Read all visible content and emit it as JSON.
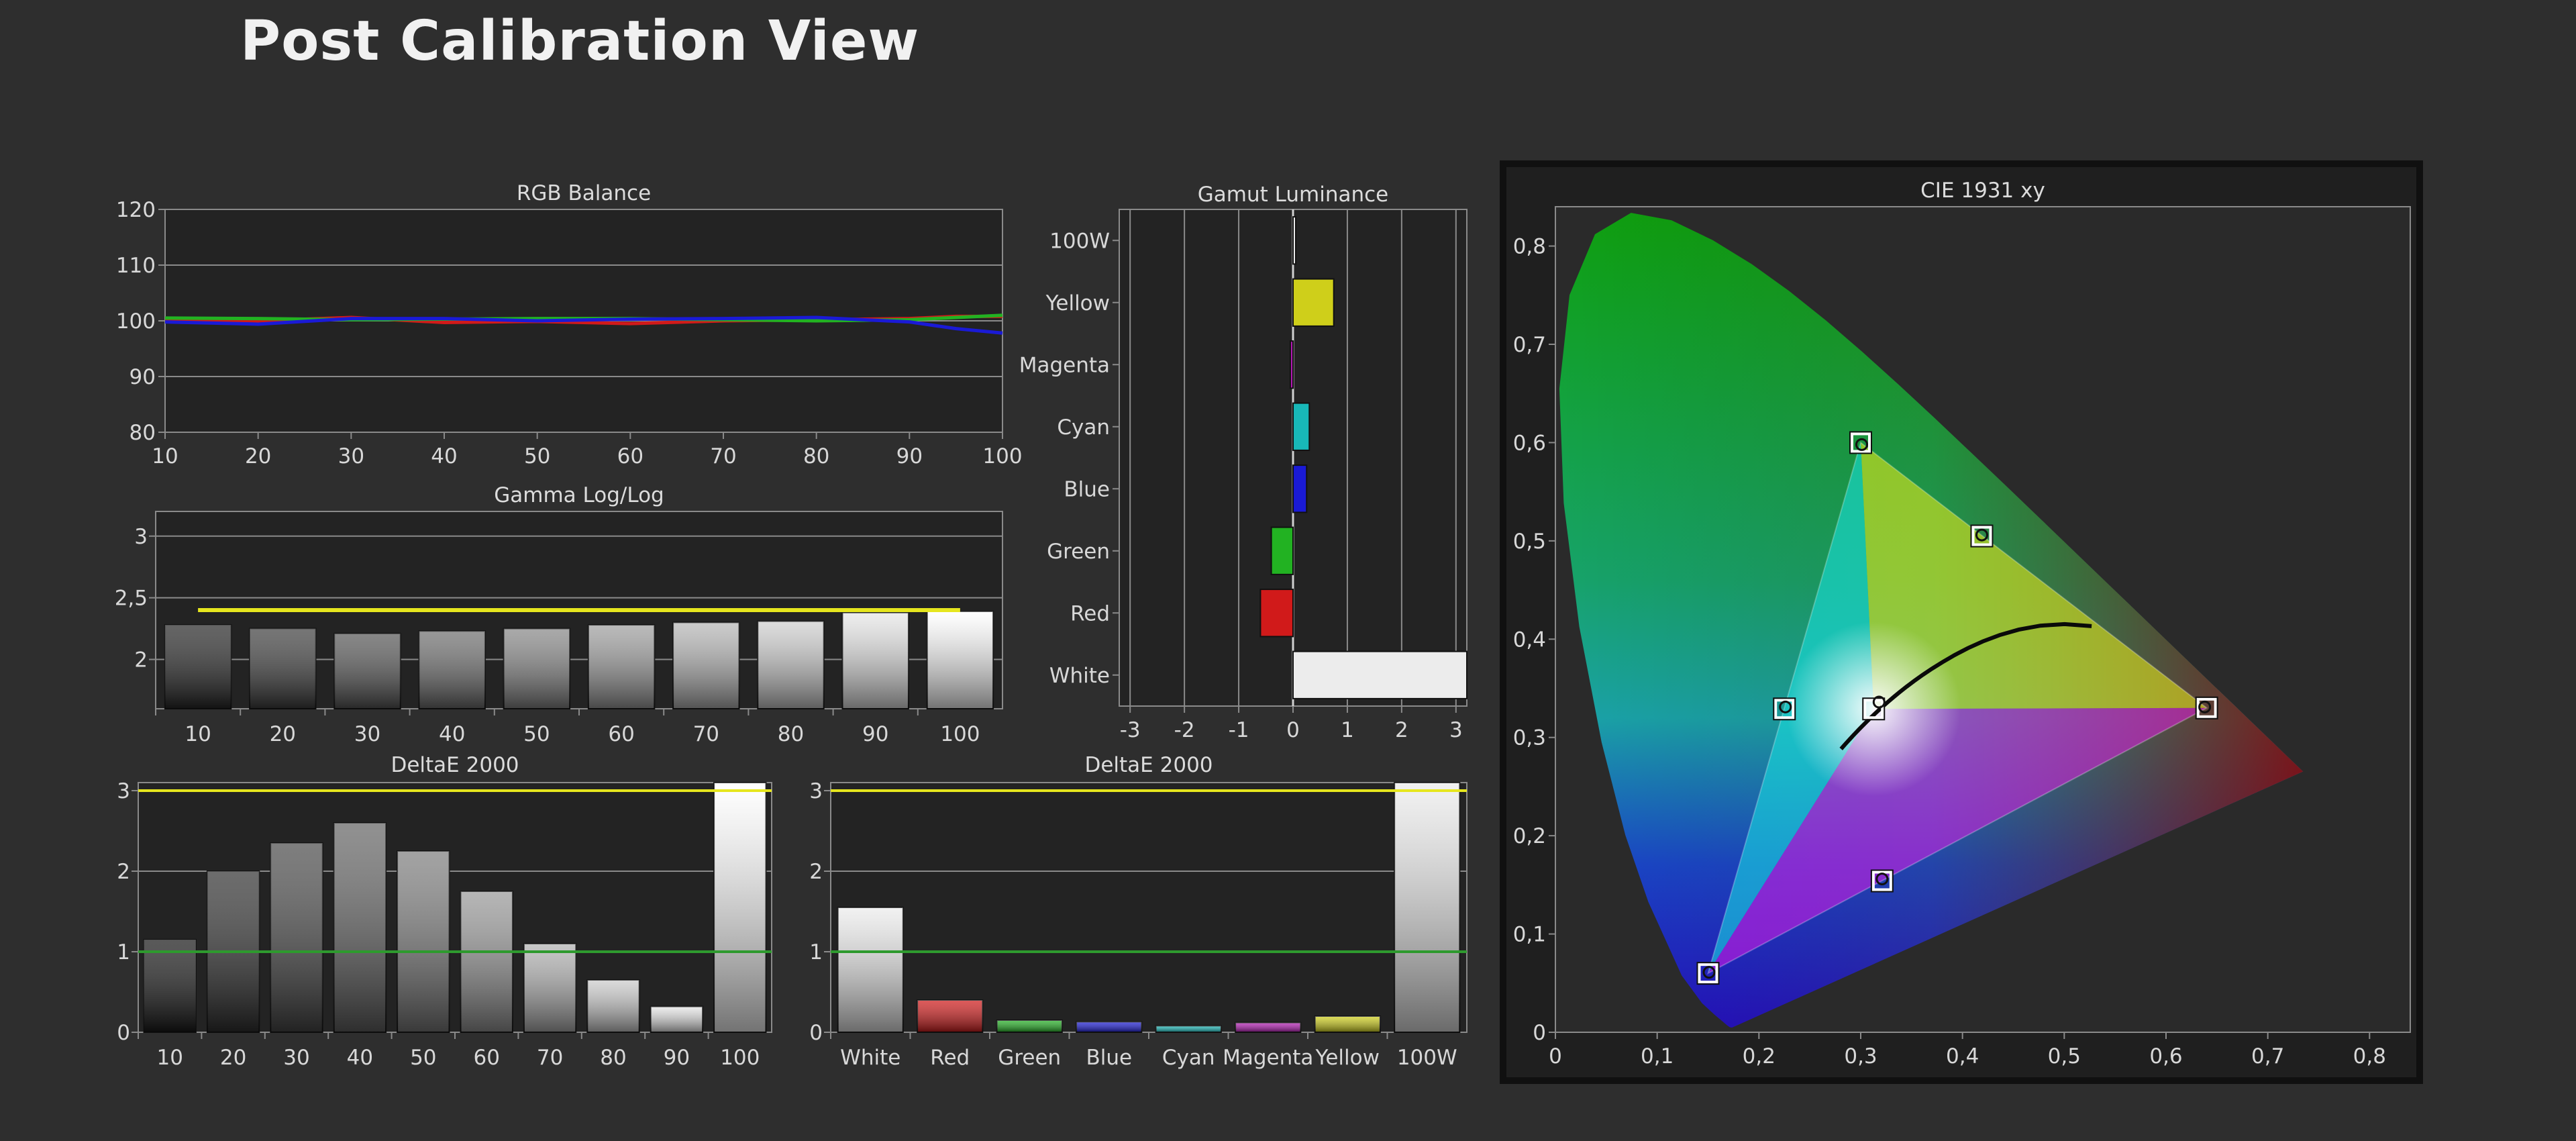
{
  "page": {
    "title": "Post Calibration View"
  },
  "colors": {
    "background": "#2e2e2e",
    "panel": "#232323",
    "grid": "#8a8a8a",
    "threshold_yellow": "#e6e61e",
    "threshold_green": "#2e9a2e",
    "red": "#d11a1a",
    "green": "#22b222",
    "blue": "#1a1ad6",
    "cyan": "#18b8b8",
    "magenta": "#b41ab4",
    "yellow": "#cfcf1a",
    "white": "#ececec"
  },
  "chart_data": [
    {
      "id": "rgb-balance",
      "type": "line",
      "title": "RGB Balance",
      "x_ticks": [
        "10",
        "20",
        "30",
        "40",
        "50",
        "60",
        "70",
        "80",
        "90",
        "100"
      ],
      "y_ticks": [
        "80",
        "90",
        "100",
        "110",
        "120"
      ],
      "xlim": [
        10,
        100
      ],
      "ylim": [
        80,
        120
      ],
      "grid": true,
      "series": [
        {
          "color": "red",
          "x": [
            10,
            20,
            30,
            40,
            50,
            60,
            70,
            80,
            90,
            95,
            100
          ],
          "y": [
            100.2,
            100.0,
            100.6,
            99.7,
            99.9,
            99.5,
            100.0,
            100.2,
            100.4,
            100.8,
            100.8
          ]
        },
        {
          "color": "green",
          "x": [
            10,
            20,
            30,
            40,
            50,
            60,
            70,
            80,
            90,
            95,
            100
          ],
          "y": [
            100.5,
            100.4,
            100.2,
            100.3,
            100.4,
            100.4,
            100.2,
            100.0,
            100.2,
            100.6,
            101.0
          ]
        },
        {
          "color": "blue",
          "x": [
            10,
            20,
            30,
            40,
            50,
            60,
            70,
            80,
            90,
            95,
            100
          ],
          "y": [
            99.8,
            99.4,
            100.4,
            100.4,
            100.0,
            100.3,
            100.4,
            100.6,
            99.8,
            98.6,
            97.8
          ]
        }
      ]
    },
    {
      "id": "gamma",
      "type": "bar",
      "title": "Gamma Log/Log",
      "categories": [
        "10",
        "20",
        "30",
        "40",
        "50",
        "60",
        "70",
        "80",
        "90",
        "100"
      ],
      "values": [
        2.28,
        2.25,
        2.21,
        2.23,
        2.25,
        2.28,
        2.3,
        2.31,
        2.38,
        2.39
      ],
      "target": 2.4,
      "y_ticks": [
        "2",
        "2,5",
        "3"
      ],
      "ylim": [
        1.6,
        3.2
      ],
      "grid": true
    },
    {
      "id": "gamut-luminance",
      "type": "bar",
      "orientation": "horizontal",
      "title": "Gamut Luminance",
      "categories": [
        "100W",
        "Yellow",
        "Magenta",
        "Cyan",
        "Blue",
        "Green",
        "Red",
        "White"
      ],
      "values": [
        0,
        0.75,
        -0.05,
        0.3,
        0.25,
        -0.4,
        -0.6,
        3.2
      ],
      "x_ticks": [
        "-3",
        "-2",
        "-1",
        "0",
        "1",
        "2",
        "3"
      ],
      "xlim": [
        -3.2,
        3.2
      ],
      "grid": true
    },
    {
      "id": "deltae-grayscale",
      "type": "bar",
      "title": "DeltaE 2000",
      "categories": [
        "10",
        "20",
        "30",
        "40",
        "50",
        "60",
        "70",
        "80",
        "90",
        "100"
      ],
      "values": [
        1.15,
        2.0,
        2.35,
        2.6,
        2.25,
        1.75,
        1.1,
        0.65,
        0.32,
        3.1
      ],
      "y_ticks": [
        "0",
        "1",
        "2",
        "3"
      ],
      "ylim": [
        0,
        3.1
      ],
      "thresholds": [
        3,
        1
      ],
      "grid": true
    },
    {
      "id": "deltae-colors",
      "type": "bar",
      "title": "DeltaE 2000",
      "categories": [
        "White",
        "Red",
        "Green",
        "Blue",
        "Cyan",
        "Magenta",
        "Yellow",
        "100W"
      ],
      "values": [
        1.55,
        0.4,
        0.15,
        0.13,
        0.08,
        0.12,
        0.2,
        3.15
      ],
      "y_ticks": [
        "0",
        "1",
        "2",
        "3"
      ],
      "ylim": [
        0,
        3.1
      ],
      "thresholds": [
        3,
        1
      ],
      "grid": true
    },
    {
      "id": "cie",
      "type": "scatter",
      "title": "CIE 1931 xy",
      "x_ticks": [
        "0",
        "0,1",
        "0,2",
        "0,3",
        "0,4",
        "0,5",
        "0,6",
        "0,7",
        "0,8"
      ],
      "y_ticks": [
        "0",
        "0,1",
        "0,2",
        "0,3",
        "0,4",
        "0,5",
        "0,6",
        "0,7",
        "0,8"
      ],
      "xlim": [
        0,
        0.84
      ],
      "ylim": [
        0,
        0.84
      ],
      "targets": [
        {
          "x": 0.64,
          "y": 0.33
        },
        {
          "x": 0.3,
          "y": 0.6
        },
        {
          "x": 0.15,
          "y": 0.06
        },
        {
          "x": 0.225,
          "y": 0.329
        },
        {
          "x": 0.321,
          "y": 0.154
        },
        {
          "x": 0.419,
          "y": 0.505
        },
        {
          "x": 0.3127,
          "y": 0.329
        }
      ],
      "measured": [
        {
          "x": 0.638,
          "y": 0.331
        },
        {
          "x": 0.301,
          "y": 0.598
        },
        {
          "x": 0.151,
          "y": 0.061
        },
        {
          "x": 0.226,
          "y": 0.331
        },
        {
          "x": 0.321,
          "y": 0.156
        },
        {
          "x": 0.419,
          "y": 0.506
        },
        {
          "x": 0.318,
          "y": 0.336
        }
      ]
    }
  ]
}
